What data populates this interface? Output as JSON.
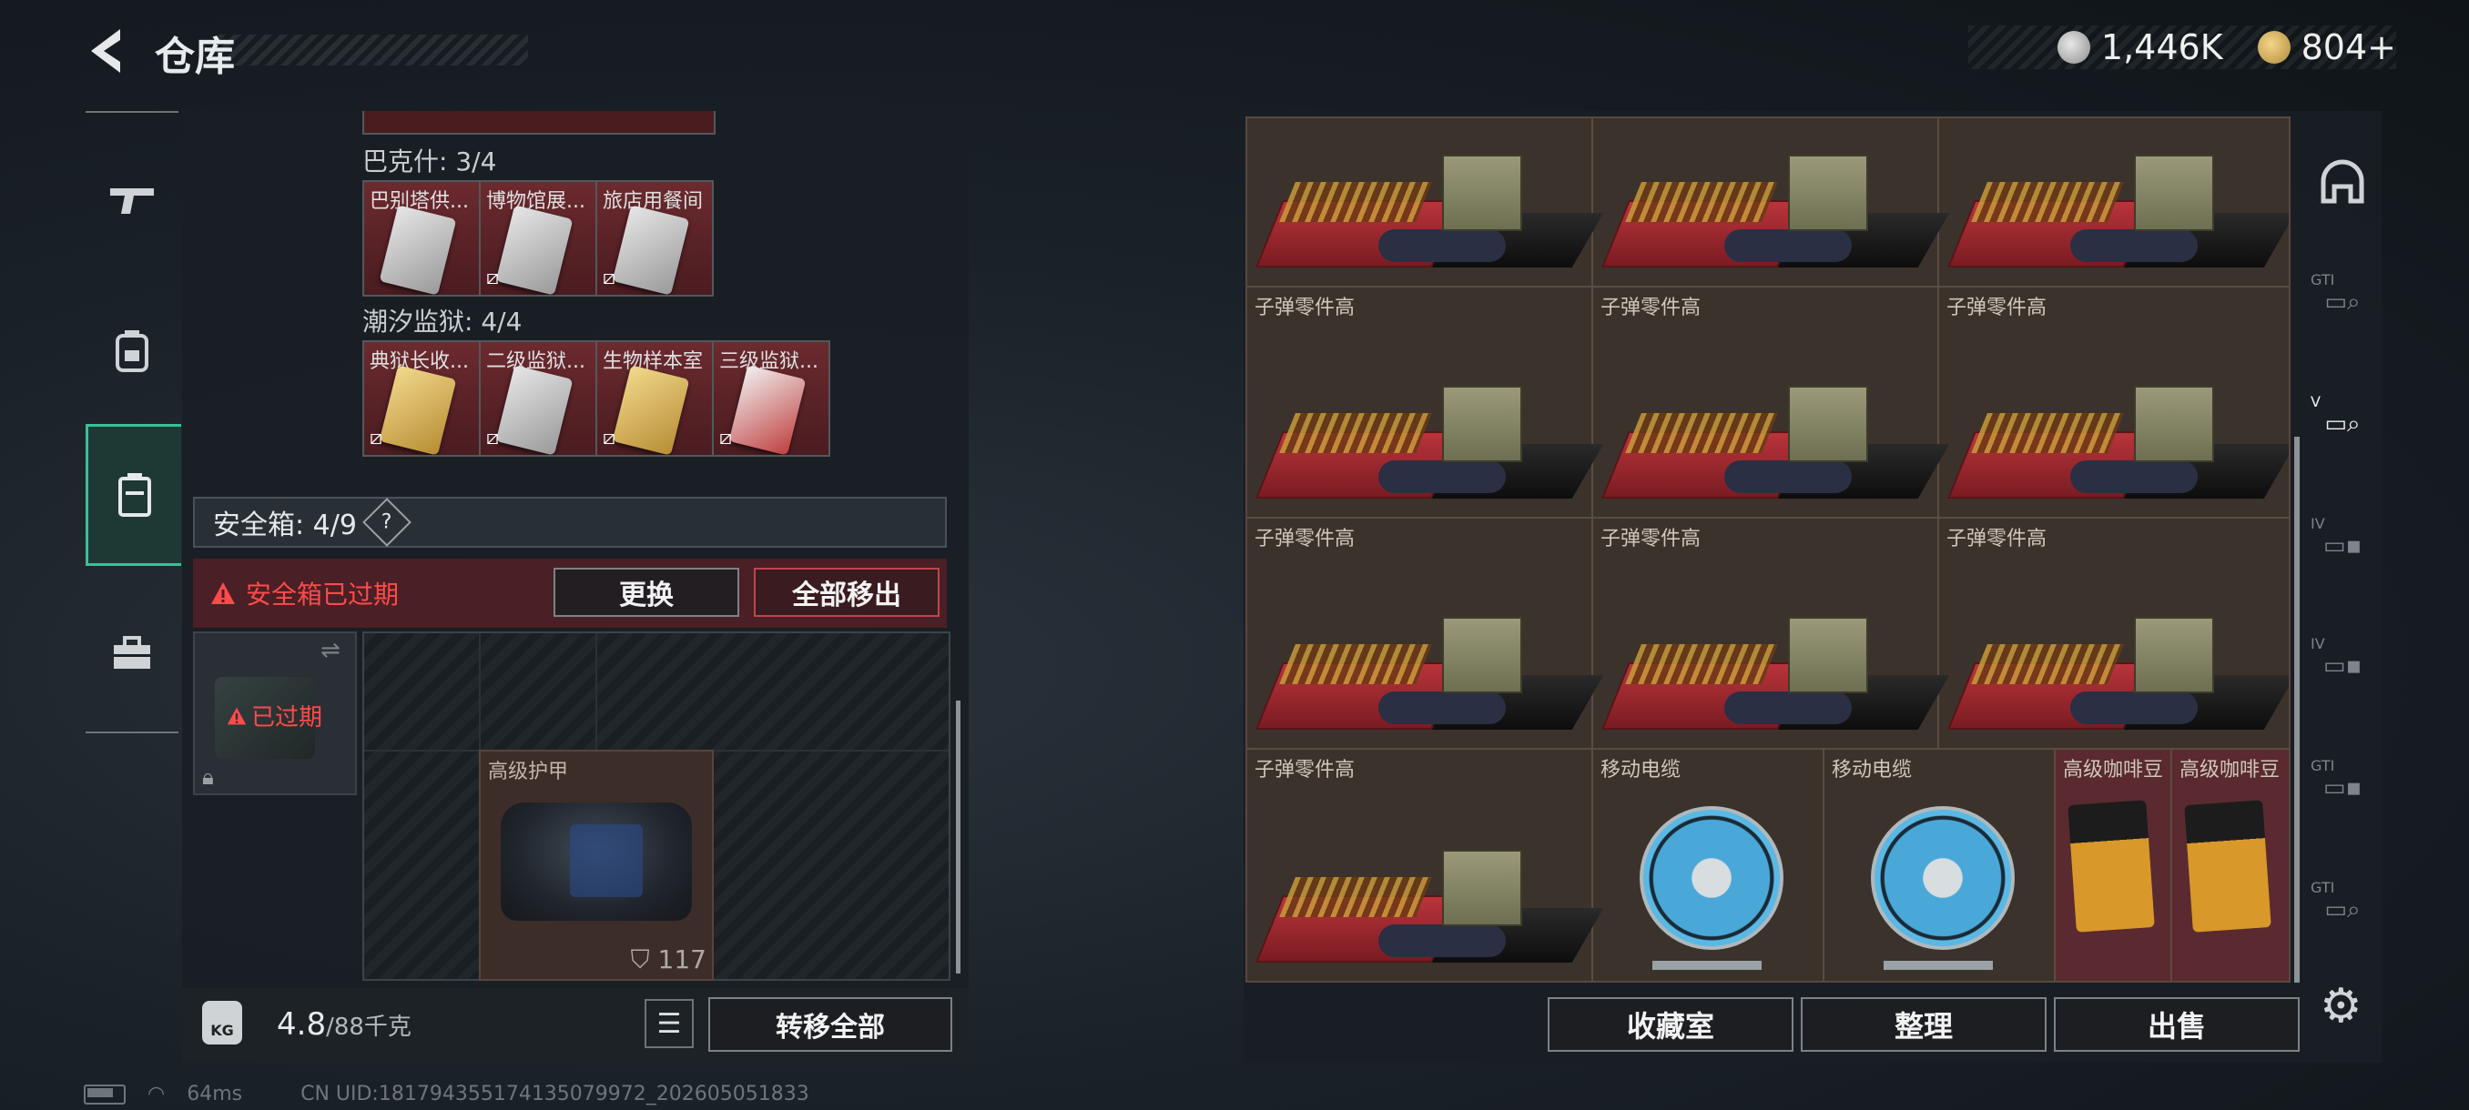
{
  "header": {
    "title": "仓库",
    "currencies": [
      {
        "icon": "silver-coin-icon",
        "value": "1,446K"
      },
      {
        "icon": "gold-coin-icon",
        "value": "804+"
      }
    ]
  },
  "left_nav": [
    {
      "icon": "gun-icon",
      "active": false
    },
    {
      "icon": "backpack-icon",
      "active": false
    },
    {
      "icon": "safe-case-icon",
      "active": true
    },
    {
      "icon": "toolbox-icon",
      "active": false
    }
  ],
  "keycards": {
    "groups": [
      {
        "label": "巴克什: 3/4",
        "cards": [
          {
            "name": "巴别塔供...",
            "locked": false
          },
          {
            "name": "博物馆展...",
            "locked": true
          },
          {
            "name": "旅店用餐间",
            "locked": true
          }
        ]
      },
      {
        "label": "潮汐监狱: 4/4",
        "cards": [
          {
            "name": "典狱长收...",
            "locked": true
          },
          {
            "name": "二级监狱...",
            "locked": true
          },
          {
            "name": "生物样本室",
            "locked": true
          },
          {
            "name": "三级监狱...",
            "locked": true
          }
        ]
      }
    ]
  },
  "safe_box": {
    "label": "安全箱: 4/9",
    "help": "?",
    "expired_warning": "安全箱已过期",
    "replace_button": "更换",
    "remove_all_button": "全部移出",
    "expired_tag": "已过期",
    "item": {
      "name": "高级护甲",
      "durability": "117"
    }
  },
  "weight": {
    "current": "4.8",
    "capacity": "/88千克",
    "kg_icon_text": "KG"
  },
  "transfer_all_button": "转移全部",
  "status_bar": {
    "ping": "64ms",
    "uid": "CN UID:1817943551741350799​72_202605051833"
  },
  "stash": {
    "items": [
      {
        "name": "",
        "type": "ammo"
      },
      {
        "name": "",
        "type": "ammo"
      },
      {
        "name": "",
        "type": "ammo"
      },
      {
        "name": "子弹零件高",
        "type": "ammo"
      },
      {
        "name": "子弹零件高",
        "type": "ammo"
      },
      {
        "name": "子弹零件高",
        "type": "ammo"
      },
      {
        "name": "子弹零件高",
        "type": "ammo"
      },
      {
        "name": "子弹零件高",
        "type": "ammo"
      },
      {
        "name": "子弹零件高",
        "type": "ammo"
      },
      {
        "name": "子弹零件高",
        "type": "ammo"
      },
      {
        "name": "移动电缆",
        "type": "reel"
      },
      {
        "name": "移动电缆",
        "type": "reel"
      },
      {
        "name": "高级咖啡豆",
        "type": "coffee"
      },
      {
        "name": "高级咖啡豆",
        "type": "coffee"
      }
    ]
  },
  "bottom_buttons": {
    "collection": "收藏室",
    "sort": "整理",
    "sell": "出售"
  },
  "right_nav": [
    {
      "icon": "helmet-icon",
      "tag": ""
    },
    {
      "icon": "storage-tab-icon",
      "tag": "GTI"
    },
    {
      "icon": "storage-tab-icon",
      "tag": "V",
      "active": true
    },
    {
      "icon": "storage-tab-icon",
      "tag": "IV"
    },
    {
      "icon": "storage-tab-icon",
      "tag": "IV"
    },
    {
      "icon": "storage-tab-icon",
      "tag": "GTI"
    },
    {
      "icon": "storage-tab-icon",
      "tag": "GTI"
    }
  ],
  "colors": {
    "accent_green": "#35c29a",
    "warning_red": "#ff4a4a",
    "slot_brown": "#3b322c",
    "slot_red": "#5a2a30"
  }
}
